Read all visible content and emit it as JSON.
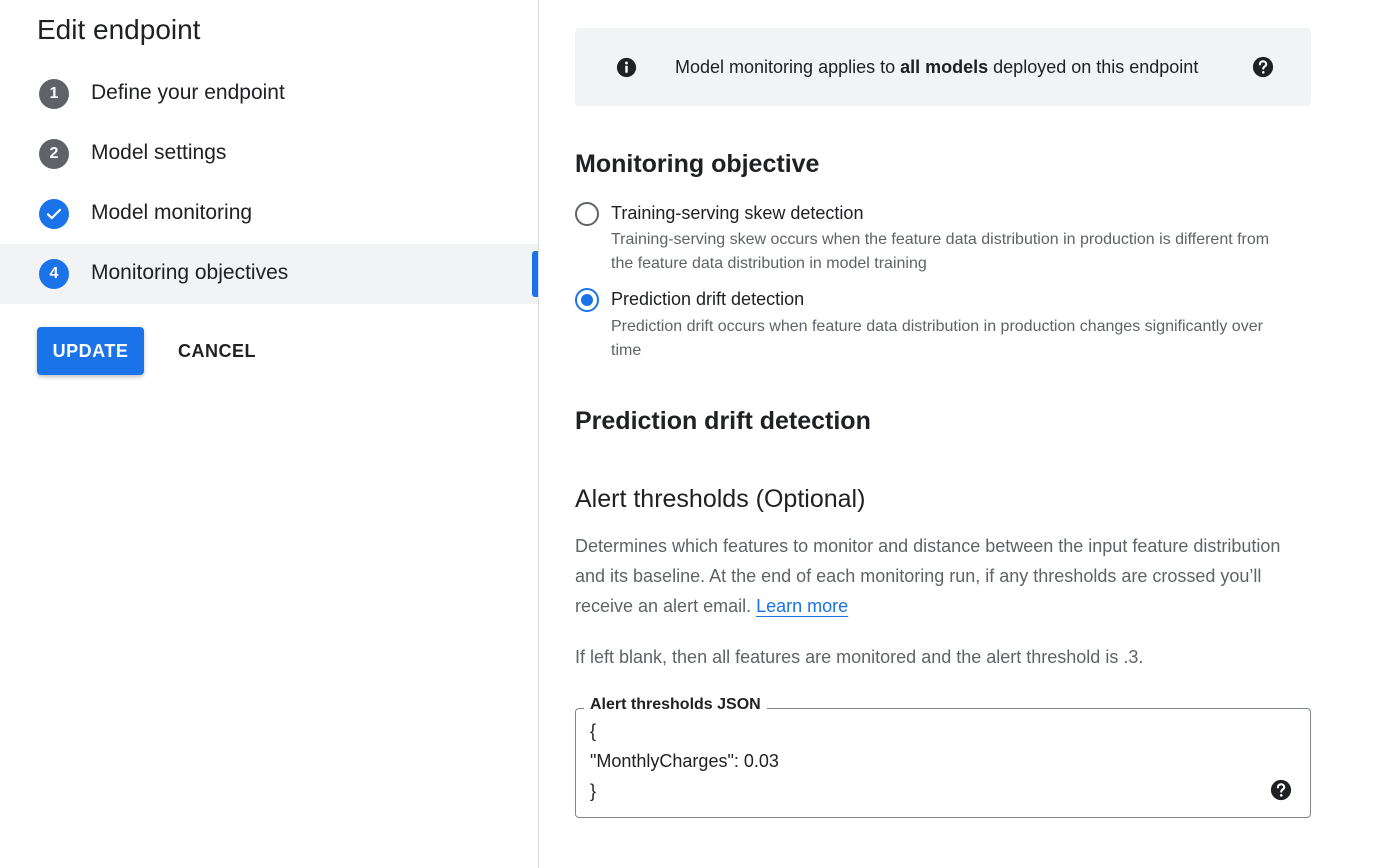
{
  "sidebar": {
    "title": "Edit endpoint",
    "steps": [
      {
        "number": "1",
        "label": "Define your endpoint",
        "state": "incomplete"
      },
      {
        "number": "2",
        "label": "Model settings",
        "state": "incomplete"
      },
      {
        "number": "",
        "label": "Model monitoring",
        "state": "complete"
      },
      {
        "number": "4",
        "label": "Monitoring objectives",
        "state": "active"
      }
    ],
    "update_label": "UPDATE",
    "cancel_label": "CANCEL"
  },
  "info_banner": {
    "text_before": "Model monitoring applies to ",
    "text_bold": "all models",
    "text_after": " deployed on this endpoint",
    "icon": "info-icon",
    "help_icon": "help-icon"
  },
  "monitoring_objective": {
    "heading": "Monitoring objective",
    "options": [
      {
        "label": "Training-serving skew detection",
        "description": "Training-serving skew occurs when the feature data distribution in production is different from the feature data distribution in model training",
        "selected": false
      },
      {
        "label": "Prediction drift detection",
        "description": "Prediction drift occurs when feature data distribution in production changes significantly over time",
        "selected": true
      }
    ]
  },
  "drift_section": {
    "heading": "Prediction drift detection"
  },
  "alert_thresholds": {
    "heading": "Alert thresholds (Optional)",
    "description": "Determines which features to monitor and distance between the input feature distribution and its baseline. At the end of each monitoring run, if any thresholds are crossed you’ll receive an alert email. ",
    "learn_more": "Learn more",
    "blank_note": "If left blank, then all features are monitored and the alert threshold is .3.",
    "json_field_label": "Alert thresholds JSON",
    "json_value": "{\n\"MonthlyCharges\": 0.03\n}"
  },
  "colors": {
    "accent": "#1a73e8",
    "step_grey": "#5f6368",
    "banner_bg": "#f1f3f4"
  }
}
